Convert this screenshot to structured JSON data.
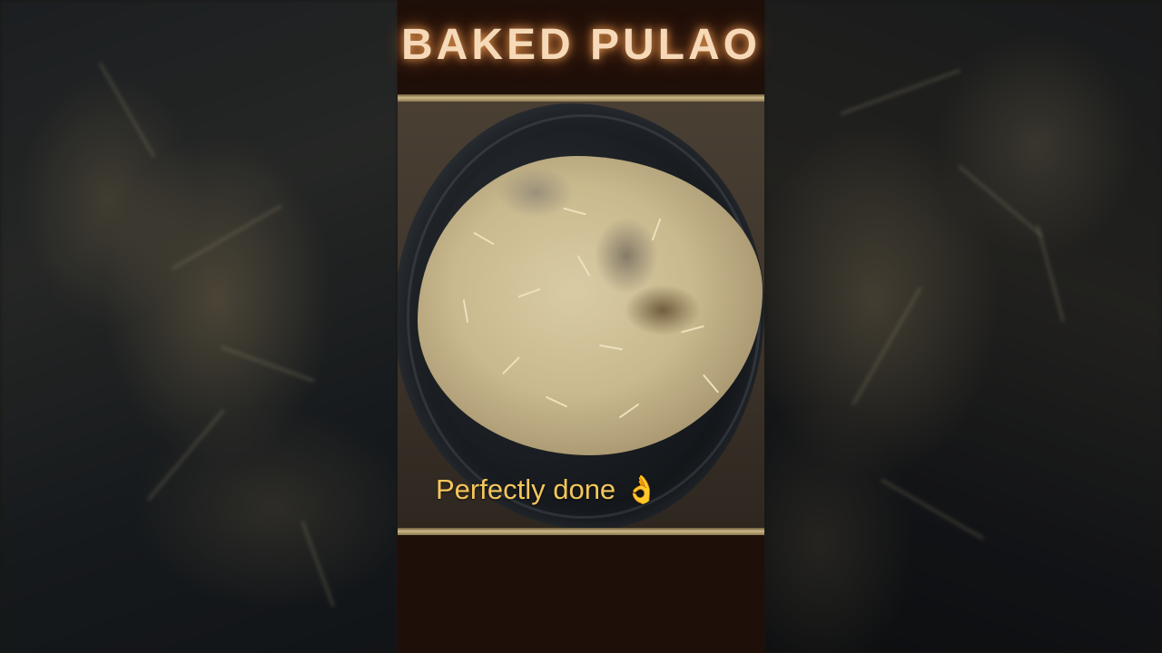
{
  "title": "BAKED PULAO",
  "caption": "Perfectly done",
  "caption_icon": "ok-hand-icon",
  "colors": {
    "title": "#f6d9b8",
    "title_glow": "#ff8c3c",
    "caption": "#f4c65a",
    "frame_bg": "#1f0f09",
    "gold_bar": "#cdb88a"
  }
}
